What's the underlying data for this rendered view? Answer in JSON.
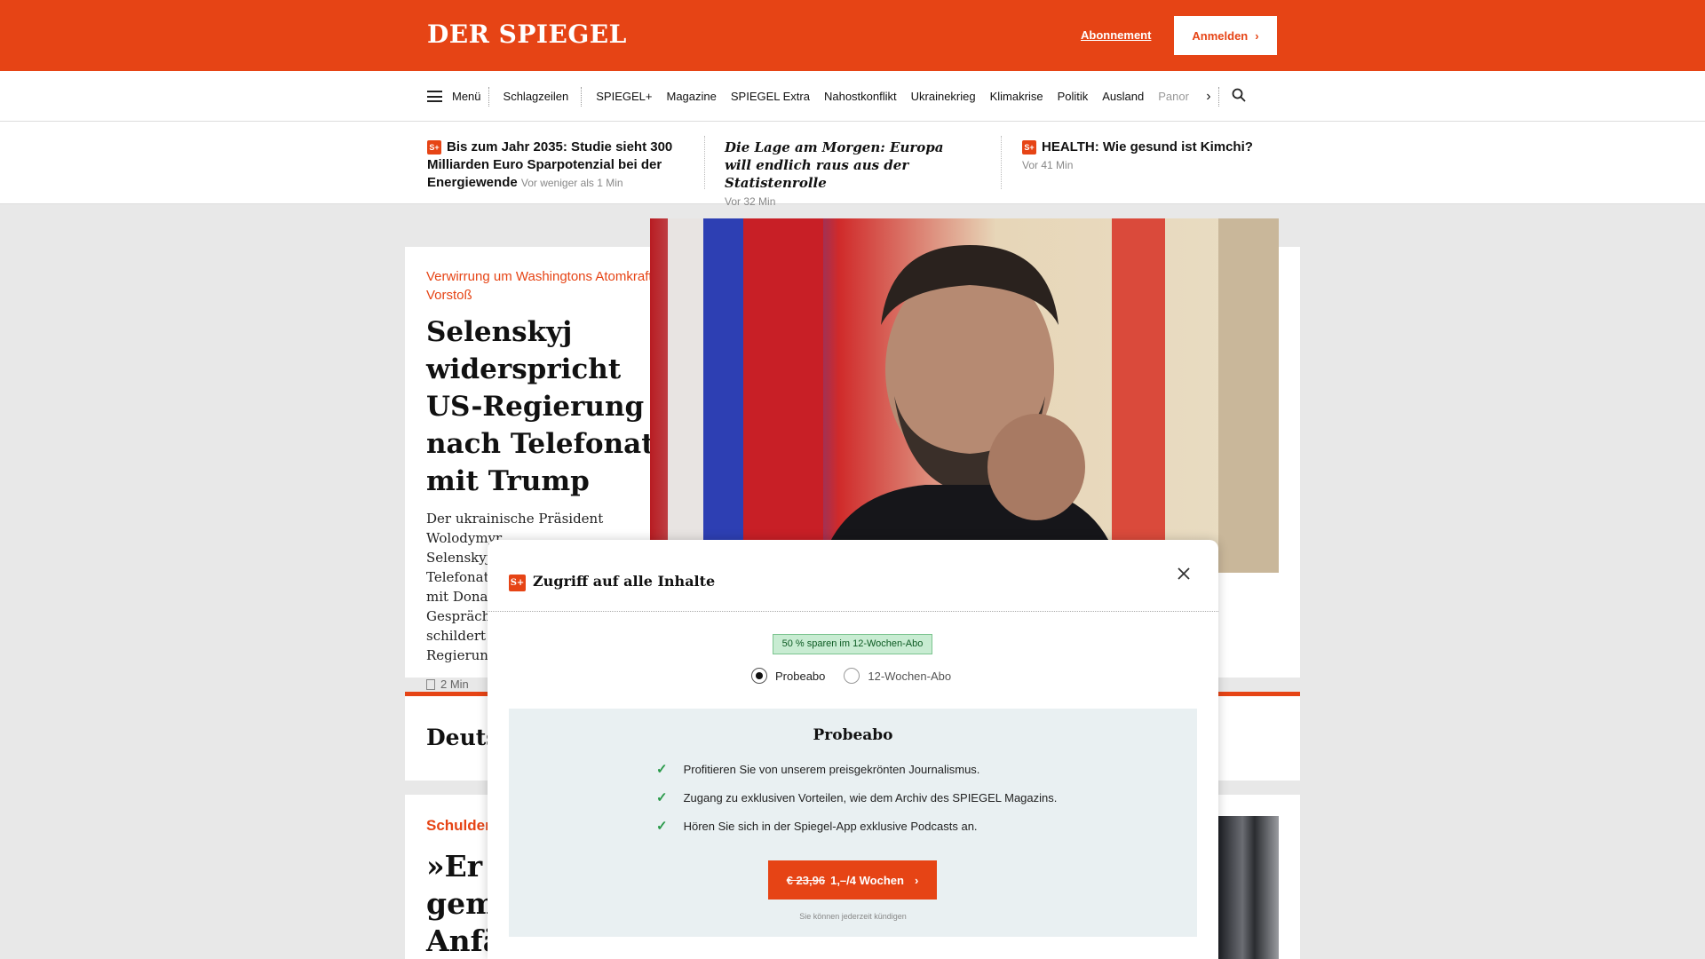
{
  "header": {
    "logo": "DER SPIEGEL",
    "subscribe_label": "Abonnement",
    "login_label": "Anmelden",
    "brand_color": "#e64415"
  },
  "nav": {
    "menu_label": "Menü",
    "items": [
      "Schlagzeilen",
      "SPIEGEL+",
      "Magazine",
      "SPIEGEL Extra",
      "Nahostkonflikt",
      "Ukrainekrieg",
      "Klimakrise",
      "Politik",
      "Ausland",
      "Panor"
    ]
  },
  "ticker": [
    {
      "title": "Bis zum Jahr 2035: Studie sieht 300 Milliarden Euro Sparpotenzial bei der Energiewende",
      "time": "Vor weniger als 1 Min",
      "plus": "S+"
    },
    {
      "title": "Die Lage am Morgen: Europa will endlich raus aus der Statistenrolle",
      "time": "Vor 32 Min"
    },
    {
      "title": "HEALTH: Wie gesund ist Kimchi?",
      "time": "Vor 41 Min",
      "plus": "S+"
    }
  ],
  "lead": {
    "kicker": "Verwirrung um Washingtons Atomkraft-Vorstoß",
    "headline": "Selenskyj widerspricht US-Regierung nach Telefonat mit Trump",
    "teaser_lines": [
      "Der ukrainische Präsident Wolodymyr",
      "Selenskyj wertet das jüngste Telefonat",
      "mit Donal",
      "Gesprächs",
      "schildert e",
      "Regierung"
    ],
    "read_time": "2 Min"
  },
  "second": {
    "headline_partial": "Deutsc"
  },
  "third": {
    "kicker_partial": "Schulden",
    "headline_lines": [
      "»Er h",
      "gema",
      "Anfä"
    ]
  },
  "modal": {
    "plus_badge": "S+",
    "title": "Zugriff auf alle Inhalte",
    "save_badge": "50 % sparen im 12-Wochen-Abo",
    "options": [
      "Probeabo",
      "12-Wochen-Abo"
    ],
    "selected": "Probeabo",
    "box_title": "Probeabo",
    "features": [
      "Profitieren Sie von unserem preisgekrönten Journalismus.",
      "Zugang zu exklusiven Vorteilen, wie dem Archiv des SPIEGEL Magazins.",
      "Hören Sie sich in der Spiegel-App exklusive Podcasts an."
    ],
    "cta_old_price": "€ 23,96",
    "cta_price": "1,–/4 Wochen",
    "cancel_note": "Sie können jederzeit kündigen"
  }
}
